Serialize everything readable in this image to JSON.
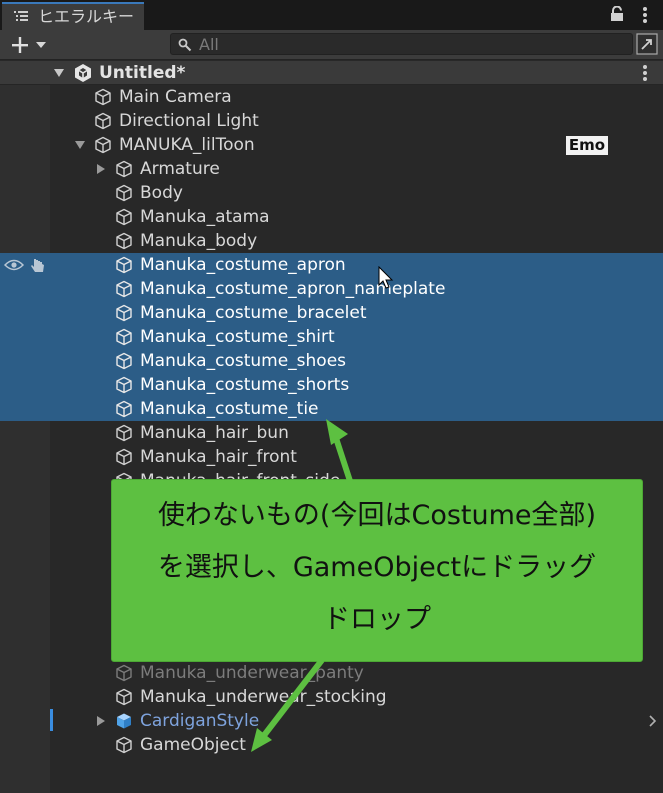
{
  "tab": {
    "label": "ヒエラルキー"
  },
  "search": {
    "placeholder": "All"
  },
  "scene": {
    "title": "Untitled*"
  },
  "badge": {
    "label": "Emo"
  },
  "items": [
    {
      "label": "Main Camera"
    },
    {
      "label": "Directional Light"
    },
    {
      "label": "MANUKA_lilToon"
    },
    {
      "label": "Armature"
    },
    {
      "label": "Body"
    },
    {
      "label": "Manuka_atama"
    },
    {
      "label": "Manuka_body"
    },
    {
      "label": "Manuka_costume_apron"
    },
    {
      "label": "Manuka_costume_apron_nameplate"
    },
    {
      "label": "Manuka_costume_bracelet"
    },
    {
      "label": "Manuka_costume_shirt"
    },
    {
      "label": "Manuka_costume_shoes"
    },
    {
      "label": "Manuka_costume_shorts"
    },
    {
      "label": "Manuka_costume_tie"
    },
    {
      "label": "Manuka_hair_bun"
    },
    {
      "label": "Manuka_hair_front"
    },
    {
      "label": "Manuka_hair_front_side"
    },
    {
      "label": "Manuka_underwear_panty"
    },
    {
      "label": "Manuka_underwear_stocking"
    },
    {
      "label": "CardiganStyle"
    },
    {
      "label": "GameObject"
    }
  ],
  "callout": {
    "line1": "使わないもの(今回はCostume全部)",
    "line2": "を選択し、GameObjectにドラッグ",
    "line3": "ドロップ"
  },
  "colors": {
    "selection": "#2c5d87",
    "callout": "#5dc041",
    "prefab": "#7ea3dd"
  }
}
